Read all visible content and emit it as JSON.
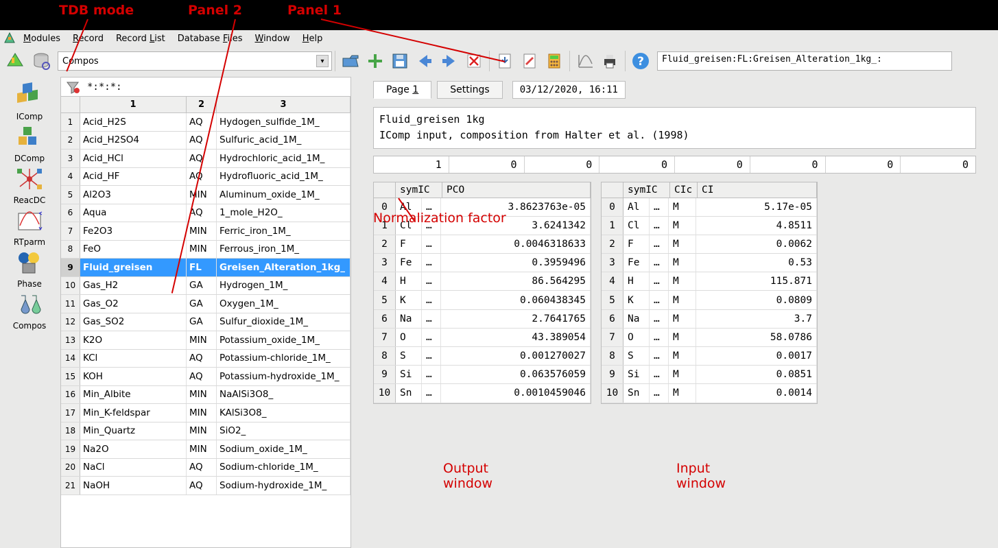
{
  "annotations": {
    "tdb_mode": "TDB mode",
    "panel2": "Panel 2",
    "panel1": "Panel 1",
    "norm_factor": "Normalization factor",
    "output_window": "Output\nwindow",
    "input_window": "Input\nwindow"
  },
  "menu": [
    "Modules",
    "Record",
    "Record List",
    "Database Files",
    "Window",
    "Help"
  ],
  "menu_underline": [
    "M",
    "R",
    "L",
    "F",
    "W",
    "H"
  ],
  "combo_value": "Compos",
  "record_path": " Fluid_greisen:FL:Greisen_Alteration_1kg_:",
  "module_buttons": [
    "IComp",
    "DComp",
    "ReacDC",
    "RTparm",
    "Phase",
    "Compos"
  ],
  "filter": "*:*:*:",
  "list_headers": [
    "",
    "1",
    "2",
    "3"
  ],
  "list_rows": [
    {
      "n": 1,
      "c1": "Acid_H2S",
      "c2": "AQ",
      "c3": "Hydogen_sulfide_1M_"
    },
    {
      "n": 2,
      "c1": "Acid_H2SO4",
      "c2": "AQ",
      "c3": "Sulfuric_acid_1M_"
    },
    {
      "n": 3,
      "c1": "Acid_HCl",
      "c2": "AQ",
      "c3": "Hydrochloric_acid_1M_"
    },
    {
      "n": 4,
      "c1": "Acid_HF",
      "c2": "AQ",
      "c3": "Hydrofluoric_acid_1M_"
    },
    {
      "n": 5,
      "c1": "Al2O3",
      "c2": "MIN",
      "c3": "Aluminum_oxide_1M_"
    },
    {
      "n": 6,
      "c1": "Aqua",
      "c2": "AQ",
      "c3": "1_mole_H2O_"
    },
    {
      "n": 7,
      "c1": "Fe2O3",
      "c2": "MIN",
      "c3": "Ferric_iron_1M_"
    },
    {
      "n": 8,
      "c1": "FeO",
      "c2": "MIN",
      "c3": "Ferrous_iron_1M_"
    },
    {
      "n": 9,
      "c1": "Fluid_greisen",
      "c2": "FL",
      "c3": "Greisen_Alteration_1kg_",
      "sel": true
    },
    {
      "n": 10,
      "c1": "Gas_H2",
      "c2": "GA",
      "c3": "Hydrogen_1M_"
    },
    {
      "n": 11,
      "c1": "Gas_O2",
      "c2": "GA",
      "c3": "Oxygen_1M_"
    },
    {
      "n": 12,
      "c1": "Gas_SO2",
      "c2": "GA",
      "c3": "Sulfur_dioxide_1M_"
    },
    {
      "n": 13,
      "c1": "K2O",
      "c2": "MIN",
      "c3": "Potassium_oxide_1M_"
    },
    {
      "n": 14,
      "c1": "KCl",
      "c2": "AQ",
      "c3": "Potassium-chloride_1M_"
    },
    {
      "n": 15,
      "c1": "KOH",
      "c2": "AQ",
      "c3": "Potassium-hydroxide_1M_"
    },
    {
      "n": 16,
      "c1": "Min_Albite",
      "c2": "MIN",
      "c3": "NaAlSi3O8_"
    },
    {
      "n": 17,
      "c1": "Min_K-feldspar",
      "c2": "MIN",
      "c3": "KAlSi3O8_"
    },
    {
      "n": 18,
      "c1": "Min_Quartz",
      "c2": "MIN",
      "c3": "SiO2_"
    },
    {
      "n": 19,
      "c1": "Na2O",
      "c2": "MIN",
      "c3": "Sodium_oxide_1M_"
    },
    {
      "n": 20,
      "c1": "NaCl",
      "c2": "AQ",
      "c3": "Sodium-chloride_1M_"
    },
    {
      "n": 21,
      "c1": "NaOH",
      "c2": "AQ",
      "c3": "Sodium-hydroxide_1M_"
    }
  ],
  "tab_page": "Page 1",
  "tab_settings": "Settings",
  "timestamp": "03/12/2020, 16:11",
  "desc_line1": "Fluid_greisen 1kg",
  "desc_line2": "IComp input, composition from Halter et al. (1998)",
  "norm_values": [
    "1",
    "0",
    "0",
    "0",
    "0",
    "0",
    "0",
    "0"
  ],
  "out_table": {
    "headers": [
      "",
      "symIC",
      "PCO"
    ],
    "rows": [
      {
        "n": 0,
        "sym": "Al",
        "d": "…",
        "v": "3.8623763e-05"
      },
      {
        "n": 1,
        "sym": "Cl",
        "d": "…",
        "v": "3.6241342"
      },
      {
        "n": 2,
        "sym": "F",
        "d": "…",
        "v": "0.0046318633"
      },
      {
        "n": 3,
        "sym": "Fe",
        "d": "…",
        "v": "0.3959496"
      },
      {
        "n": 4,
        "sym": "H",
        "d": "…",
        "v": "86.564295"
      },
      {
        "n": 5,
        "sym": "K",
        "d": "…",
        "v": "0.060438345"
      },
      {
        "n": 6,
        "sym": "Na",
        "d": "…",
        "v": "2.7641765"
      },
      {
        "n": 7,
        "sym": "O",
        "d": "…",
        "v": "43.389054"
      },
      {
        "n": 8,
        "sym": "S",
        "d": "…",
        "v": "0.001270027"
      },
      {
        "n": 9,
        "sym": "Si",
        "d": "…",
        "v": "0.063576059"
      },
      {
        "n": 10,
        "sym": "Sn",
        "d": "…",
        "v": "0.0010459046"
      }
    ]
  },
  "in_table": {
    "headers": [
      "",
      "symIC",
      "CIc",
      "CI"
    ],
    "rows": [
      {
        "n": 0,
        "sym": "Al",
        "d": "…",
        "u": "M",
        "v": "5.17e-05"
      },
      {
        "n": 1,
        "sym": "Cl",
        "d": "…",
        "u": "M",
        "v": "4.8511"
      },
      {
        "n": 2,
        "sym": "F",
        "d": "…",
        "u": "M",
        "v": "0.0062"
      },
      {
        "n": 3,
        "sym": "Fe",
        "d": "…",
        "u": "M",
        "v": "0.53"
      },
      {
        "n": 4,
        "sym": "H",
        "d": "…",
        "u": "M",
        "v": "115.871"
      },
      {
        "n": 5,
        "sym": "K",
        "d": "…",
        "u": "M",
        "v": "0.0809"
      },
      {
        "n": 6,
        "sym": "Na",
        "d": "…",
        "u": "M",
        "v": "3.7"
      },
      {
        "n": 7,
        "sym": "O",
        "d": "…",
        "u": "M",
        "v": "58.0786"
      },
      {
        "n": 8,
        "sym": "S",
        "d": "…",
        "u": "M",
        "v": "0.0017"
      },
      {
        "n": 9,
        "sym": "Si",
        "d": "…",
        "u": "M",
        "v": "0.0851"
      },
      {
        "n": 10,
        "sym": "Sn",
        "d": "…",
        "u": "M",
        "v": "0.0014"
      }
    ]
  }
}
